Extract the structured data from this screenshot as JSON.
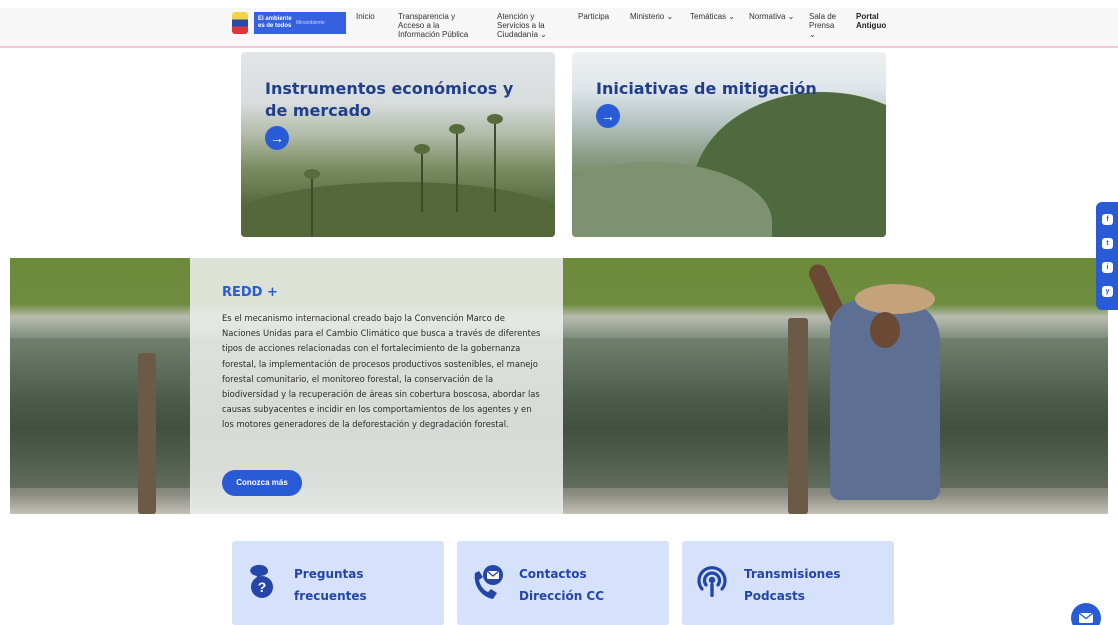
{
  "header": {
    "brand": {
      "main": "El ambiente es de todos",
      "sub": "Minambiente"
    },
    "nav": [
      {
        "label": "Inicio"
      },
      {
        "label": "Transparencia y Acceso a la Información Pública"
      },
      {
        "label": "Atención y Servicios a la Ciudadanía ⌄"
      },
      {
        "label": "Participa"
      },
      {
        "label": "Ministerio ⌄"
      },
      {
        "label": "Temáticas ⌄"
      },
      {
        "label": "Normativa ⌄"
      },
      {
        "label": "Sala de Prensa ⌄"
      },
      {
        "label": "Portal Antiguo"
      }
    ]
  },
  "cards": [
    {
      "title": "Instrumentos económicos y de mercado",
      "button_icon": "→"
    },
    {
      "title": "Iniciativas de mitigación",
      "button_icon": "→"
    }
  ],
  "redd": {
    "title": "REDD +",
    "body": "Es el mecanismo internacional creado bajo la Convención Marco de Naciones Unidas para el Cambio Climático que busca a través de diferentes tipos de acciones relacionadas con el fortalecimiento de la gobernanza forestal, la implementación de procesos productivos sostenibles, el manejo forestal comunitario, el monitoreo forestal, la conservación de la biodiversidad y la recuperación de áreas sin cobertura boscosa, abordar las causas subyacentes e incidir en los comportamientos de los agentes y en los motores generadores de la deforestación y degradación forestal.",
    "button_label": "Conozca más"
  },
  "social": [
    "f",
    "t",
    "i",
    "y"
  ],
  "quick_links": [
    {
      "label": "Preguntas frecuentes",
      "icon": "faq-icon"
    },
    {
      "label": "Contactos Dirección CC",
      "icon": "contact-icon"
    },
    {
      "label": "Transmisiones Podcasts",
      "icon": "podcast-icon"
    }
  ],
  "colors": {
    "primary": "#2a5bd7",
    "title_blue": "#1f3f8c",
    "box_bg": "#d6e1fb"
  }
}
